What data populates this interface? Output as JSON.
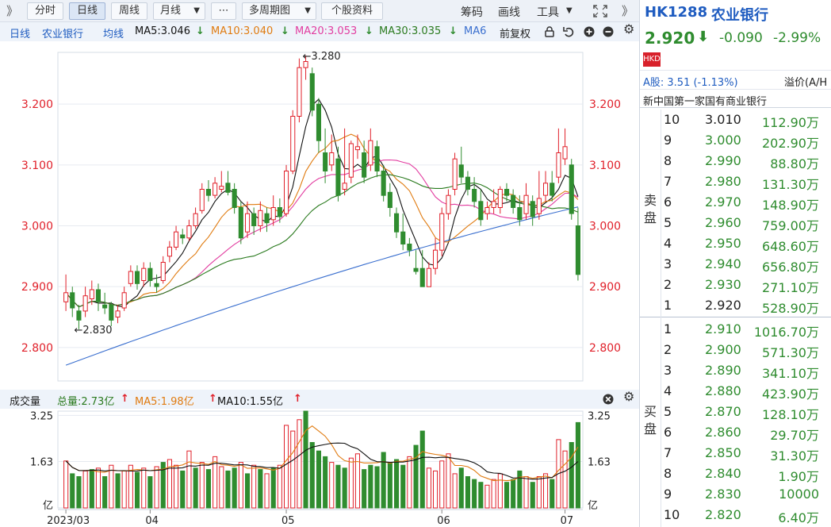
{
  "toolbar": {
    "collapse": "》",
    "tabs": [
      "分时",
      "日线",
      "周线"
    ],
    "month": "月线",
    "more": "⋯",
    "multi": "多周期图",
    "profile": "个股资料",
    "right": [
      "筹码",
      "画线",
      "工具"
    ]
  },
  "ma_legend": {
    "period": "日线",
    "name": "农业银行",
    "avg": "均线",
    "ma5": "MA5:3.046",
    "ma10": "MA10:3.040",
    "ma20": "MA20:3.053",
    "ma30": "MA30:3.035",
    "ma6": "MA6",
    "adj": "前复权"
  },
  "volume_legend": {
    "title": "成交量",
    "total": "总量:2.73亿",
    "ma5": "MA5:1.98亿",
    "ma10": "MA10:1.55亿"
  },
  "colors": {
    "up": "#e0202a",
    "down": "#2f8c2f",
    "ma5": "#111111",
    "ma10": "#e07b10",
    "ma20": "#e23da0",
    "ma30": "#2a7a1e",
    "ma60": "#3a6fcf",
    "blue": "#1f5cc0"
  },
  "chart_data": {
    "type": "candlestick",
    "price_axis": {
      "ticks": [
        "3.200",
        "3.100",
        "3.000",
        "2.900",
        "2.800"
      ],
      "ylim": [
        2.745,
        3.285
      ]
    },
    "volume_axis": {
      "ticks": [
        "3.25",
        "1.63"
      ],
      "unit": "亿",
      "ylim": [
        0,
        3.4
      ]
    },
    "x_tick_labels": [
      "2023/03",
      "04",
      "05",
      "06",
      "07"
    ],
    "annotations": {
      "high": "3.280",
      "low": "2.830"
    },
    "candles": [
      [
        2.875,
        2.89,
        2.92,
        2.86
      ],
      [
        2.89,
        2.865,
        2.9,
        2.85
      ],
      [
        2.86,
        2.845,
        2.87,
        2.83
      ],
      [
        2.86,
        2.885,
        2.9,
        2.85
      ],
      [
        2.88,
        2.895,
        2.91,
        2.87
      ],
      [
        2.895,
        2.875,
        2.905,
        2.86
      ],
      [
        2.87,
        2.865,
        2.89,
        2.855
      ],
      [
        2.87,
        2.845,
        2.875,
        2.835
      ],
      [
        2.85,
        2.86,
        2.87,
        2.84
      ],
      [
        2.865,
        2.89,
        2.9,
        2.86
      ],
      [
        2.905,
        2.925,
        2.935,
        2.9
      ],
      [
        2.925,
        2.905,
        2.935,
        2.895
      ],
      [
        2.91,
        2.93,
        2.94,
        2.9
      ],
      [
        2.93,
        2.91,
        2.94,
        2.9
      ],
      [
        2.905,
        2.9,
        2.92,
        2.89
      ],
      [
        2.91,
        2.94,
        2.95,
        2.905
      ],
      [
        2.95,
        2.965,
        2.975,
        2.94
      ],
      [
        2.965,
        2.99,
        3.0,
        2.96
      ],
      [
        2.985,
        2.98,
        2.995,
        2.97
      ],
      [
        2.98,
        3.0,
        3.01,
        2.975
      ],
      [
        3.0,
        3.02,
        3.03,
        2.995
      ],
      [
        3.025,
        3.06,
        3.07,
        3.02
      ],
      [
        3.06,
        3.05,
        3.075,
        3.04
      ],
      [
        3.05,
        3.07,
        3.08,
        3.045
      ],
      [
        3.06,
        3.065,
        3.09,
        3.055
      ],
      [
        3.07,
        3.055,
        3.09,
        3.05
      ],
      [
        3.06,
        3.03,
        3.07,
        3.02
      ],
      [
        3.03,
        2.98,
        3.04,
        2.97
      ],
      [
        2.99,
        3.02,
        3.04,
        2.98
      ],
      [
        3.02,
        3.0,
        3.03,
        2.985
      ],
      [
        3.0,
        3.025,
        3.04,
        2.99
      ],
      [
        3.02,
        3.005,
        3.03,
        2.99
      ],
      [
        3.01,
        3.03,
        3.05,
        3.0
      ],
      [
        3.03,
        3.015,
        3.045,
        3.005
      ],
      [
        3.02,
        3.09,
        3.1,
        3.015
      ],
      [
        3.09,
        3.18,
        3.19,
        3.085
      ],
      [
        3.18,
        3.26,
        3.275,
        3.17
      ],
      [
        3.26,
        3.27,
        3.28,
        3.24
      ],
      [
        3.25,
        3.19,
        3.26,
        3.18
      ],
      [
        3.2,
        3.14,
        3.21,
        3.12
      ],
      [
        3.12,
        3.09,
        3.16,
        3.07
      ],
      [
        3.1,
        3.12,
        3.15,
        3.09
      ],
      [
        3.11,
        3.05,
        3.13,
        3.04
      ],
      [
        3.06,
        3.07,
        3.16,
        3.05
      ],
      [
        3.08,
        3.135,
        3.14,
        3.07
      ],
      [
        3.125,
        3.13,
        3.15,
        3.11
      ],
      [
        3.12,
        3.08,
        3.14,
        3.07
      ],
      [
        3.1,
        3.14,
        3.16,
        3.09
      ],
      [
        3.13,
        3.09,
        3.14,
        3.08
      ],
      [
        3.09,
        3.05,
        3.1,
        3.04
      ],
      [
        3.055,
        3.03,
        3.07,
        3.015
      ],
      [
        3.02,
        2.99,
        3.03,
        2.98
      ],
      [
        2.99,
        2.97,
        3.02,
        2.96
      ],
      [
        2.97,
        2.96,
        2.98,
        2.95
      ],
      [
        2.93,
        2.925,
        2.96,
        2.92
      ],
      [
        2.93,
        2.9,
        2.96,
        2.9
      ],
      [
        2.9,
        2.93,
        2.94,
        2.9
      ],
      [
        2.93,
        2.96,
        2.98,
        2.92
      ],
      [
        2.96,
        3.02,
        3.03,
        2.95
      ],
      [
        3.02,
        3.05,
        3.06,
        3.01
      ],
      [
        3.06,
        3.11,
        3.12,
        3.05
      ],
      [
        3.1,
        3.08,
        3.13,
        3.07
      ],
      [
        3.08,
        3.06,
        3.09,
        3.05
      ],
      [
        3.06,
        3.04,
        3.08,
        3.03
      ],
      [
        3.04,
        3.01,
        3.06,
        3.0
      ],
      [
        3.02,
        3.03,
        3.04,
        3.01
      ],
      [
        3.03,
        3.04,
        3.06,
        3.02
      ],
      [
        3.03,
        3.06,
        3.065,
        3.02
      ],
      [
        3.06,
        3.05,
        3.07,
        3.04
      ],
      [
        3.05,
        3.03,
        3.06,
        3.02
      ],
      [
        3.03,
        3.01,
        3.05,
        3.0
      ],
      [
        3.02,
        3.05,
        3.07,
        3.01
      ],
      [
        3.04,
        3.015,
        3.05,
        3.0
      ],
      [
        3.02,
        3.045,
        3.09,
        3.01
      ],
      [
        3.05,
        3.07,
        3.09,
        3.04
      ],
      [
        3.07,
        3.05,
        3.09,
        3.04
      ],
      [
        3.08,
        3.12,
        3.16,
        3.07
      ],
      [
        3.11,
        3.13,
        3.16,
        3.1
      ],
      [
        3.1,
        3.02,
        3.11,
        3.01
      ],
      [
        3.0,
        2.92,
        3.03,
        2.91
      ]
    ],
    "volumes": [
      [
        1.65,
        1
      ],
      [
        1.2,
        -1
      ],
      [
        1.1,
        -1
      ],
      [
        1.3,
        1
      ],
      [
        1.35,
        -1
      ],
      [
        1.4,
        1
      ],
      [
        1.1,
        -1
      ],
      [
        1.5,
        1
      ],
      [
        1.2,
        -1
      ],
      [
        1.3,
        1
      ],
      [
        1.5,
        1
      ],
      [
        1.25,
        -1
      ],
      [
        1.4,
        1
      ],
      [
        1.1,
        -1
      ],
      [
        1.45,
        1
      ],
      [
        1.6,
        -1
      ],
      [
        1.7,
        1
      ],
      [
        1.5,
        1
      ],
      [
        1.3,
        -1
      ],
      [
        2.0,
        1
      ],
      [
        1.4,
        -1
      ],
      [
        1.6,
        1
      ],
      [
        1.35,
        -1
      ],
      [
        1.8,
        1
      ],
      [
        1.45,
        1
      ],
      [
        1.3,
        -1
      ],
      [
        1.4,
        -1
      ],
      [
        1.6,
        1
      ],
      [
        1.2,
        -1
      ],
      [
        1.5,
        1
      ],
      [
        1.35,
        -1
      ],
      [
        1.2,
        1
      ],
      [
        1.4,
        -1
      ],
      [
        1.5,
        1
      ],
      [
        2.9,
        1
      ],
      [
        2.7,
        1
      ],
      [
        3.1,
        1
      ],
      [
        3.4,
        -1
      ],
      [
        2.3,
        -1
      ],
      [
        2.0,
        -1
      ],
      [
        1.8,
        -1
      ],
      [
        1.6,
        1
      ],
      [
        1.5,
        -1
      ],
      [
        1.4,
        -1
      ],
      [
        1.75,
        1
      ],
      [
        1.9,
        1
      ],
      [
        1.35,
        -1
      ],
      [
        1.5,
        -1
      ],
      [
        1.45,
        -1
      ],
      [
        1.95,
        -1
      ],
      [
        1.6,
        -1
      ],
      [
        1.7,
        -1
      ],
      [
        1.5,
        -1
      ],
      [
        1.8,
        1
      ],
      [
        2.2,
        -1
      ],
      [
        2.7,
        -1
      ],
      [
        1.4,
        1
      ],
      [
        1.3,
        1
      ],
      [
        1.65,
        1
      ],
      [
        1.9,
        1
      ],
      [
        1.2,
        1
      ],
      [
        1.4,
        -1
      ],
      [
        1.1,
        -1
      ],
      [
        1.0,
        -1
      ],
      [
        0.9,
        -1
      ],
      [
        0.8,
        1
      ],
      [
        1.0,
        1
      ],
      [
        1.2,
        1
      ],
      [
        0.9,
        -1
      ],
      [
        1.0,
        -1
      ],
      [
        1.3,
        -1
      ],
      [
        1.1,
        1
      ],
      [
        0.9,
        -1
      ],
      [
        1.1,
        1
      ],
      [
        1.2,
        1
      ],
      [
        1.0,
        -1
      ],
      [
        2.4,
        1
      ],
      [
        2.0,
        1
      ],
      [
        2.3,
        -1
      ],
      [
        3.0,
        -1
      ]
    ]
  },
  "quote": {
    "code": "HK1288",
    "name": "农业银行",
    "price": "2.920",
    "change": "-0.090",
    "pct": "-2.99%",
    "badge": "HKD",
    "ashare": "A股: 3.51 (-1.13%)",
    "premium": "溢价(A/H",
    "desc": "新中国第一家国有商业银行",
    "sell_label": [
      "卖",
      "盘"
    ],
    "buy_label": [
      "买",
      "盘"
    ],
    "asks": [
      [
        "10",
        "3.010",
        "112.90万"
      ],
      [
        "9",
        "3.000",
        "202.90万"
      ],
      [
        "8",
        "2.990",
        "88.80万"
      ],
      [
        "7",
        "2.980",
        "131.30万"
      ],
      [
        "6",
        "2.970",
        "148.90万"
      ],
      [
        "5",
        "2.960",
        "759.00万"
      ],
      [
        "4",
        "2.950",
        "648.60万"
      ],
      [
        "3",
        "2.940",
        "656.80万"
      ],
      [
        "2",
        "2.930",
        "271.10万"
      ],
      [
        "1",
        "2.920",
        "528.90万"
      ]
    ],
    "bids": [
      [
        "1",
        "2.910",
        "1016.70万"
      ],
      [
        "2",
        "2.900",
        "571.30万"
      ],
      [
        "3",
        "2.890",
        "341.10万"
      ],
      [
        "4",
        "2.880",
        "423.90万"
      ],
      [
        "5",
        "2.870",
        "128.10万"
      ],
      [
        "6",
        "2.860",
        "29.70万"
      ],
      [
        "7",
        "2.850",
        "31.30万"
      ],
      [
        "8",
        "2.840",
        "1.90万"
      ],
      [
        "9",
        "2.830",
        "10000"
      ],
      [
        "10",
        "2.820",
        "6.40万"
      ]
    ]
  }
}
